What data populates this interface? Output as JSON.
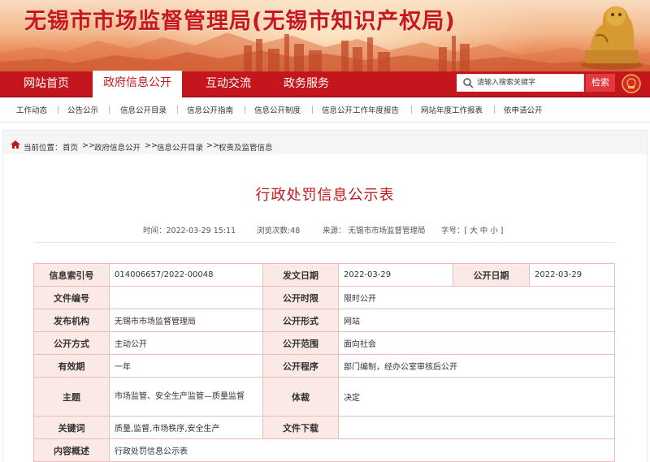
{
  "site": {
    "title": "无锡市市场监督管理局(无锡市知识产权局)"
  },
  "main_nav": {
    "items": [
      "网站首页",
      "政府信息公开",
      "互动交流",
      "政务服务"
    ],
    "search_placeholder": "请输入搜索关键字",
    "search_button": "检索"
  },
  "sub_nav": [
    "工作动态",
    "公告公示",
    "信息公开目录",
    "信息公开指南",
    "信息公开制度",
    "信息公开工作年度报告",
    "网站年度工作报表",
    "依申请公开"
  ],
  "breadcrumb": {
    "prefix": "当前位置：",
    "items": [
      "首页",
      "政府信息公开",
      "信息公开目录",
      "权责及监管信息"
    ],
    "separator": ">>"
  },
  "article": {
    "title": "行政处罚信息公示表",
    "time": "时间：2022-03-29 15:11",
    "views": "浏览次数:48",
    "source": "来源： 无锡市市场监督管理局",
    "font_size": "字号：[ 大 中 小 ]"
  },
  "info_table": {
    "index_no_label": "信息索引号",
    "index_no": "014006657/2022-00048",
    "issue_date_label": "发文日期",
    "issue_date": "2022-03-29",
    "publish_date_label": "公开日期",
    "publish_date": "2022-03-29",
    "doc_no_label": "文件编号",
    "doc_no": "",
    "time_limit_label": "公开时限",
    "time_limit": "限时公开",
    "issuer_label": "发布机构",
    "issuer": "无锡市市场监督管理局",
    "form_label": "公开形式",
    "form": "网站",
    "method_label": "公开方式",
    "method": "主动公开",
    "scope_label": "公开范围",
    "scope": "面向社会",
    "validity_label": "有效期",
    "validity": "一年",
    "procedure_label": "公开程序",
    "procedure": "部门编制，经办公室审核后公开",
    "subject_label": "主题",
    "subject": "市场监管、安全生产监管—质量监督",
    "genre_label": "体裁",
    "genre": "决定",
    "keywords_label": "关键词",
    "keywords": "质量,监督,市场秩序,安全生产",
    "download_label": "文件下载",
    "download": "",
    "summary_label": "内容概述",
    "summary": "行政处罚信息公示表"
  }
}
